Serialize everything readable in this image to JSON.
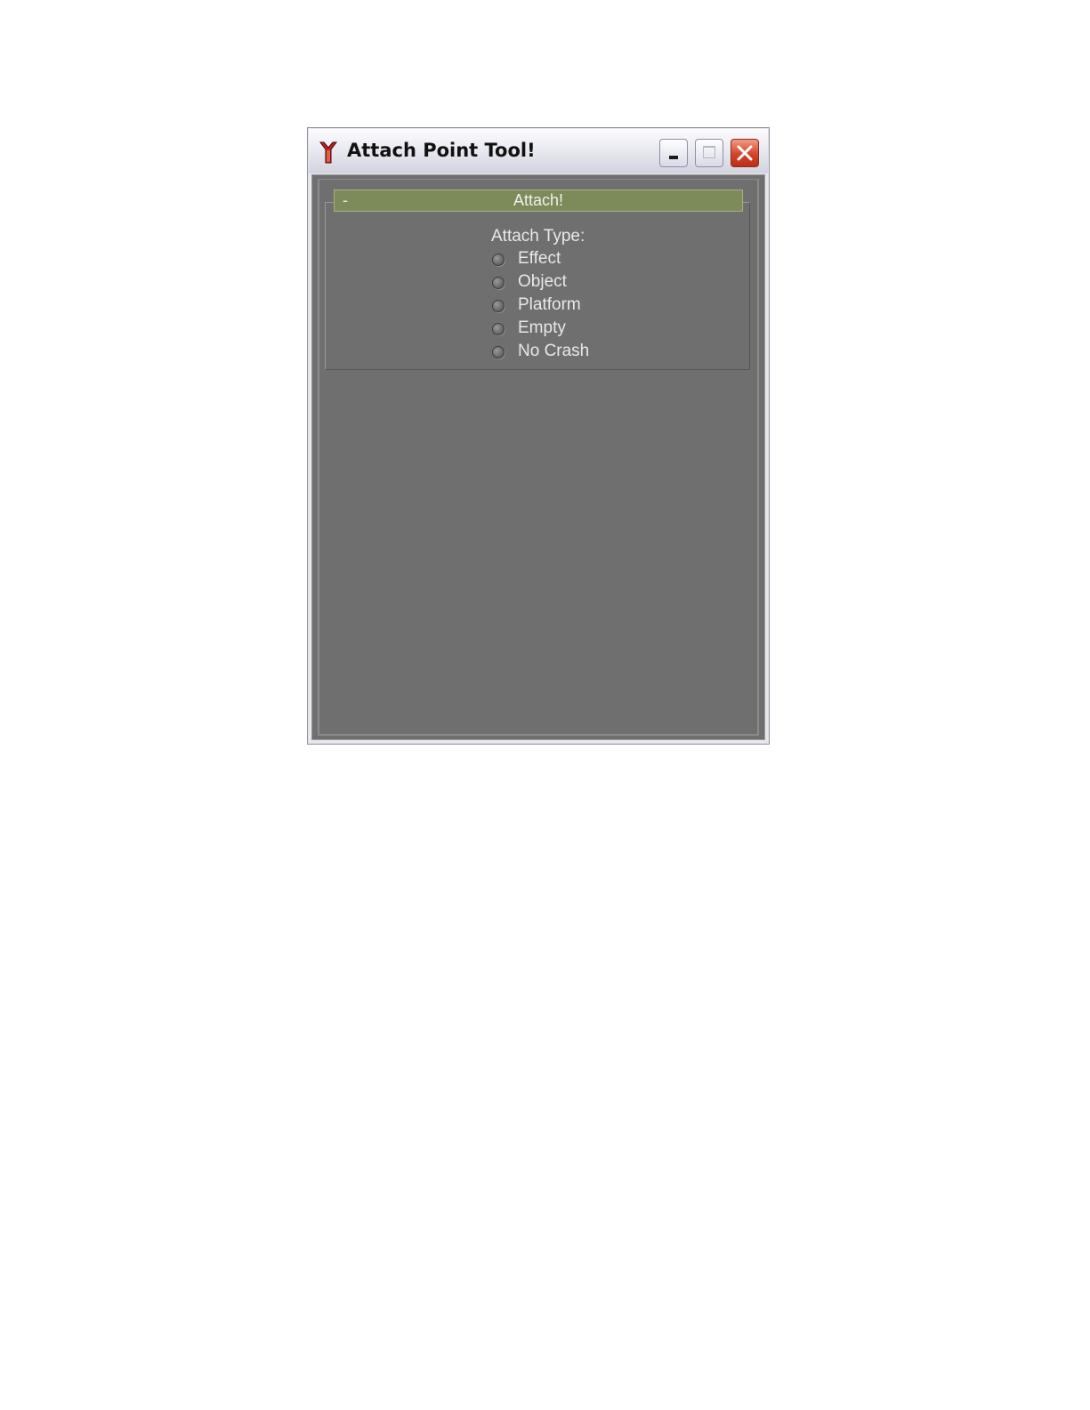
{
  "window": {
    "title": "Attach Point Tool!",
    "buttons": {
      "minimize": "minimize-icon",
      "maximize": "maximize-icon",
      "close": "close-icon"
    }
  },
  "rollout": {
    "toggle": "-",
    "title": "Attach!",
    "group_label": "Attach Type:",
    "options": [
      {
        "label": "Effect",
        "selected": false
      },
      {
        "label": "Object",
        "selected": false
      },
      {
        "label": "Platform",
        "selected": false
      },
      {
        "label": "Empty",
        "selected": false
      },
      {
        "label": "No Crash",
        "selected": false
      }
    ]
  },
  "colors": {
    "rollout_header": "#7d8b5b",
    "panel_background": "#6f6f6f",
    "close_button": "#d4442a"
  }
}
